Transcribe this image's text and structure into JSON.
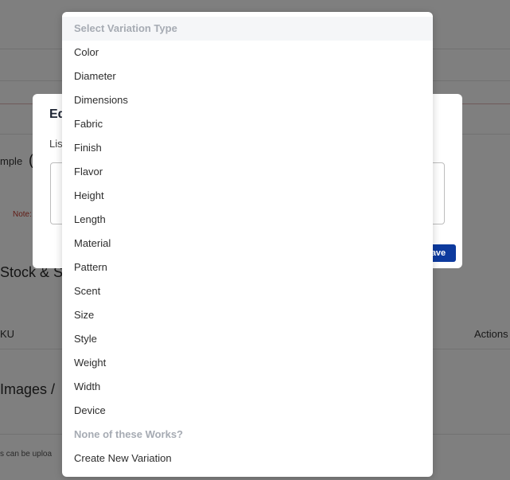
{
  "background": {
    "left_fragment_1": "mple",
    "left_fragment_2": "(",
    "note_fragment": "Note:",
    "section_stock": "Stock & S",
    "sku_header": "KU",
    "actions_header": "Actions",
    "section_images": "Images /",
    "upload_hint": "s can be uploa"
  },
  "modal": {
    "title": "Ed",
    "list_label": "Lis",
    "save_label": "ave"
  },
  "dropdown": {
    "header": "Select Variation Type",
    "options": [
      "Color",
      "Diameter",
      "Dimensions",
      "Fabric",
      "Finish",
      "Flavor",
      "Height",
      "Length",
      "Material",
      "Pattern",
      "Scent",
      "Size",
      "Style",
      "Weight",
      "Width",
      "Device"
    ],
    "group_label": "None of these Works?",
    "create_option": "Create New Variation"
  },
  "colors": {
    "overlay": "#808080",
    "save_button": "#0d3a9e",
    "muted_text": "#a6abb3"
  }
}
